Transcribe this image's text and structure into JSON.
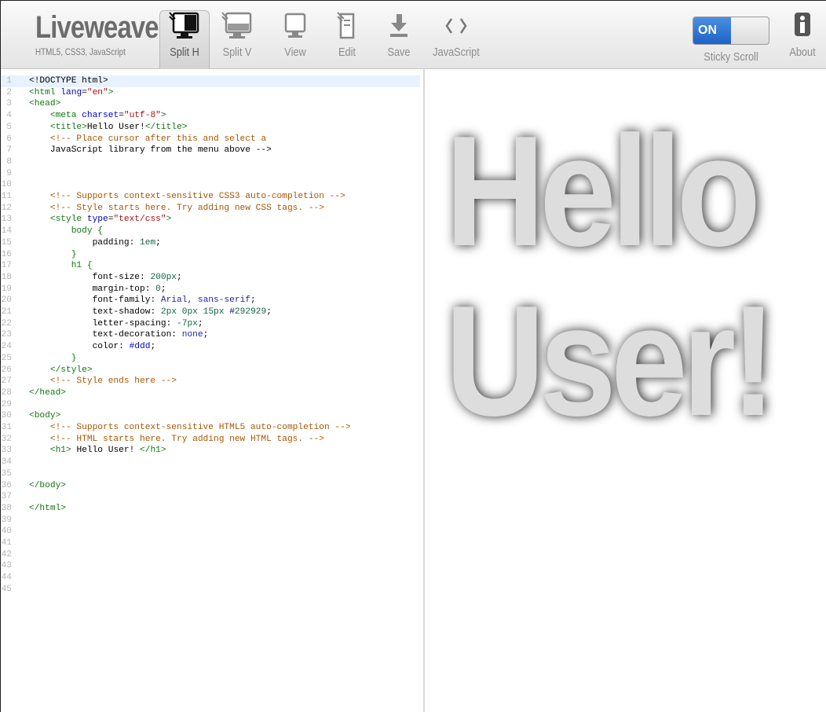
{
  "app": {
    "name": "Liveweave",
    "tagline": "HTML5, CSS3, JavaScript"
  },
  "toolbar": {
    "buttons": [
      {
        "id": "split-h",
        "label": "Split H",
        "icon": "split-horizontal-icon",
        "active": true
      },
      {
        "id": "split-v",
        "label": "Split V",
        "icon": "split-vertical-icon",
        "active": false
      },
      {
        "id": "view",
        "label": "View",
        "icon": "monitor-icon",
        "active": false
      },
      {
        "id": "edit",
        "label": "Edit",
        "icon": "edit-page-icon",
        "active": false
      },
      {
        "id": "save",
        "label": "Save",
        "icon": "download-icon",
        "active": false
      },
      {
        "id": "javascript",
        "label": "JavaScript",
        "icon": "code-brackets-icon",
        "active": false
      }
    ],
    "sticky_scroll": {
      "state": "ON",
      "label": "Sticky Scroll"
    },
    "about": {
      "label": "About",
      "icon": "info-icon"
    }
  },
  "editor": {
    "highlighted_line": 1,
    "lines": [
      "<!DOCTYPE html>",
      "<html lang=\"en\">",
      "<head>",
      "    <meta charset=\"utf-8\">",
      "    <title>Hello User!</title>",
      "    <!-- Place cursor after this and select a",
      "    JavaScript library from the menu above -->",
      "",
      "",
      "",
      "    <!-- Supports context-sensitive CSS3 auto-completion -->",
      "    <!-- Style starts here. Try adding new CSS tags. -->",
      "    <style type=\"text/css\">",
      "        body {",
      "            padding: 1em;",
      "        }",
      "        h1 {",
      "            font-size: 200px;",
      "            margin-top: 0;",
      "            font-family: Arial, sans-serif;",
      "            text-shadow: 2px 0px 15px #292929;",
      "            letter-spacing: -7px;",
      "            text-decoration: none;",
      "            color: #ddd;",
      "        }",
      "    </style>",
      "    <!-- Style ends here -->",
      "</head>",
      "",
      "<body>",
      "    <!-- Supports context-sensitive HTML5 auto-completion -->",
      "    <!-- HTML starts here. Try adding new HTML tags. -->",
      "    <h1> Hello User! </h1>",
      "",
      "",
      "</body>",
      "",
      "</html>",
      "",
      "",
      "",
      "",
      "",
      "",
      ""
    ]
  },
  "preview": {
    "heading": "Hello User!"
  },
  "colors": {
    "accent": "#1d63c6",
    "heading_text": "#dddddd",
    "heading_shadow": "#292929",
    "gutter": "#b3b3b3",
    "active_line": "#e8f2ff"
  }
}
